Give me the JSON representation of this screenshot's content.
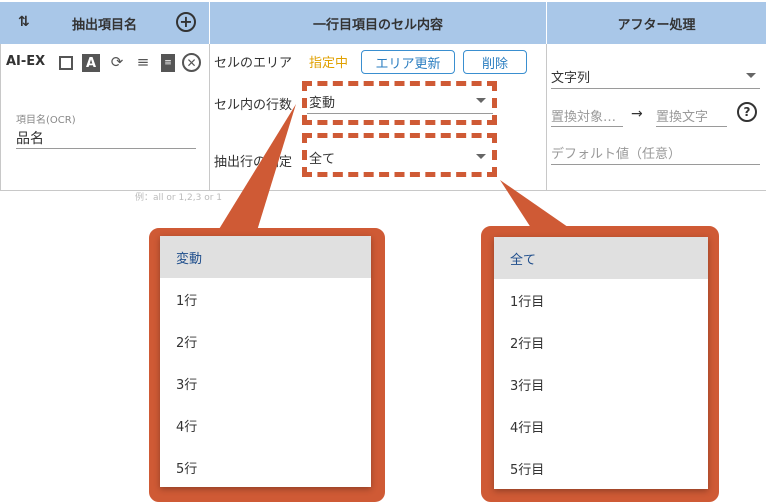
{
  "header": {
    "col1": "抽出項目名",
    "col2": "一行目項目のセル内容",
    "col3": "アフター処理"
  },
  "row": {
    "ai_ex": "AI-EX",
    "field_label": "項目名(OCR)",
    "field_value": "品名",
    "cell_area_label": "セルのエリア",
    "cell_area_status": "指定中",
    "area_update_button": "エリア更新",
    "delete_button": "削除",
    "rows_in_cell_label": "セル内の行数",
    "rows_in_cell_value": "変動",
    "extract_row_label": "抽出行の指定",
    "extract_row_value": "全て",
    "type_value": "文字列",
    "replace_target_placeholder": "置換対象…",
    "arrow": "→",
    "replace_text_placeholder": "置換文字",
    "default_placeholder": "デフォルト値（任意）"
  },
  "menu_left": {
    "items": [
      "変動",
      "1行",
      "2行",
      "3行",
      "4行",
      "5行"
    ],
    "selected": "変動"
  },
  "menu_right": {
    "items": [
      "全て",
      "1行目",
      "2行目",
      "3行目",
      "4行目",
      "5行目"
    ],
    "selected": "全て"
  },
  "colors": {
    "header_bg": "#a9c7e8",
    "callout": "#cf5a35",
    "status": "#e0a000",
    "button": "#2a7dc0"
  }
}
